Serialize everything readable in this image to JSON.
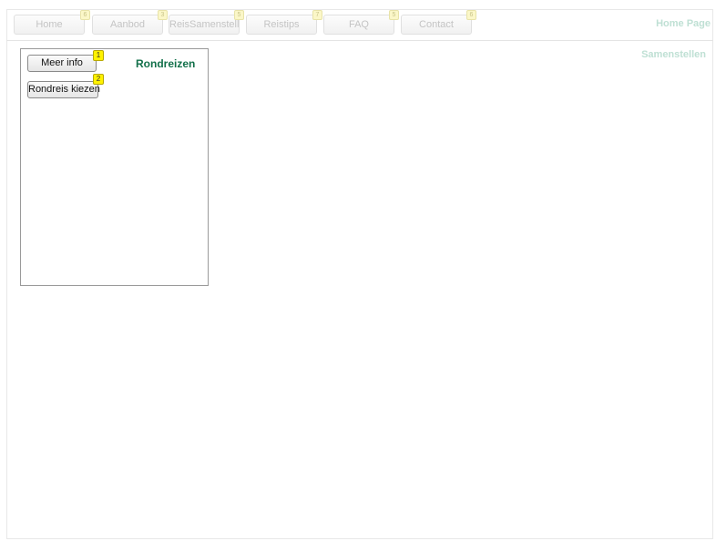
{
  "nav": {
    "items": [
      {
        "label": "Home",
        "badge": "6"
      },
      {
        "label": "Aanbod",
        "badge": "3"
      },
      {
        "label": "ReisSamenstellen",
        "badge": "5"
      },
      {
        "label": "Reistips",
        "badge": "7"
      },
      {
        "label": "FAQ",
        "badge": "5"
      },
      {
        "label": "Contact",
        "badge": "6"
      }
    ]
  },
  "header": {
    "page_title": "Home Page",
    "subtitle": "Samenstellen"
  },
  "panel": {
    "title": "Rondreizen",
    "meer_info": {
      "label": "Meer info",
      "badge": "1"
    },
    "rondreis_kiezen": {
      "label": "Rondreis kiezen",
      "badge": "2"
    }
  },
  "colors": {
    "accent_green": "#12704a",
    "faint_green": "#bfe0d4",
    "badge_yellow": "#fff200"
  }
}
